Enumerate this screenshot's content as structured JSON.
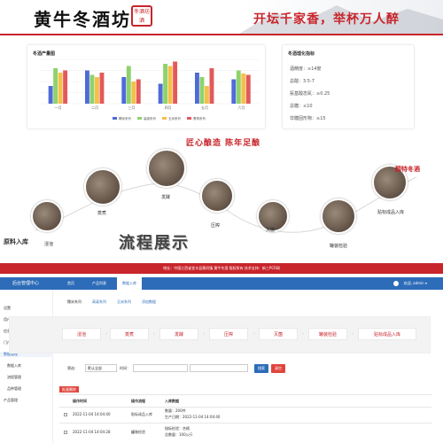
{
  "header": {
    "brand": "黄牛冬酒坊",
    "seal_text": "冬酒坊酒",
    "slogan": "开坛千家香，举杯万人醉"
  },
  "stats_card": {
    "title": "冬酒产量图",
    "legend": [
      "糯米系列",
      "高粱系列",
      "玉米系列",
      "黑枸系列"
    ],
    "colors": [
      "#4f6bd8",
      "#8ed26b",
      "#f5c04a",
      "#e3595a"
    ]
  },
  "chart_data": {
    "type": "bar",
    "categories": [
      "一月",
      "二月",
      "三月",
      "四月",
      "五月",
      "六月"
    ],
    "series": [
      {
        "name": "糯米系列",
        "values": [
          40,
          75,
          60,
          45,
          70,
          55
        ]
      },
      {
        "name": "高粱系列",
        "values": [
          80,
          65,
          85,
          90,
          60,
          75
        ]
      },
      {
        "name": "玉米系列",
        "values": [
          70,
          60,
          50,
          85,
          40,
          68
        ]
      },
      {
        "name": "黑枸系列",
        "values": [
          75,
          70,
          55,
          95,
          80,
          65
        ]
      }
    ],
    "ylim": [
      0,
      100
    ]
  },
  "indicators": {
    "title": "冬酒理化指标",
    "rows": [
      "酒精度：≥14度",
      "总酸：3.5-7",
      "氨基酸态氮：≥0.25",
      "总糖：≤10",
      "非糖固形物：≥15"
    ]
  },
  "process": {
    "headline": "匠心酿造  陈年足酿",
    "big_title": "流程展示",
    "left_label": "原料入库",
    "right_label": "醇特冬酒",
    "steps": [
      "浸泡",
      "蒸煮",
      "发酵",
      "压榨",
      "灭菌",
      "罐装检验",
      "贴标成品入库"
    ]
  },
  "address": "地址：中国江西省宜丰县黄冈镇 黄牛冬酒 版权所有 技术支持：新三PCR网",
  "admin": {
    "system_name": "后台管理中心",
    "top_nav": [
      "首页",
      "产品列表",
      "数据入库"
    ],
    "user": "欢迎, admin ▾",
    "sidebar": [
      "设置",
      "用户管理",
      "信息中心",
      "门户管理",
      "数据管理",
      "数据入库",
      "流程管理",
      "品种管理",
      "产品管理"
    ],
    "subtabs": [
      "糯米系列",
      "高粱系列",
      "玉米系列",
      "添加数据"
    ],
    "flow_steps": [
      "浸泡",
      "蒸煮",
      "发酵",
      "压榨",
      "灭菌",
      "罐装检验",
      "贴标成品入库"
    ],
    "filter_label": "筛选：",
    "filter_default": "默认全部",
    "time_label": "时间：",
    "search_btn": "搜索",
    "reset_btn": "清空",
    "delete_btn": "批量删除",
    "table_headers": [
      "操作时间",
      "操作流程",
      "入库数据"
    ],
    "rows": [
      {
        "time": "2022-11-04 14:04:40",
        "step": "贴标成品入库",
        "data1": "数量：200件",
        "data2": "生产日期：2022-11-04 14:04:40"
      },
      {
        "time": "2022-11-04 14:04:28",
        "step": "罐装检验",
        "data1": "指标检验：合格",
        "data2": "总数量：100公斤"
      }
    ]
  }
}
